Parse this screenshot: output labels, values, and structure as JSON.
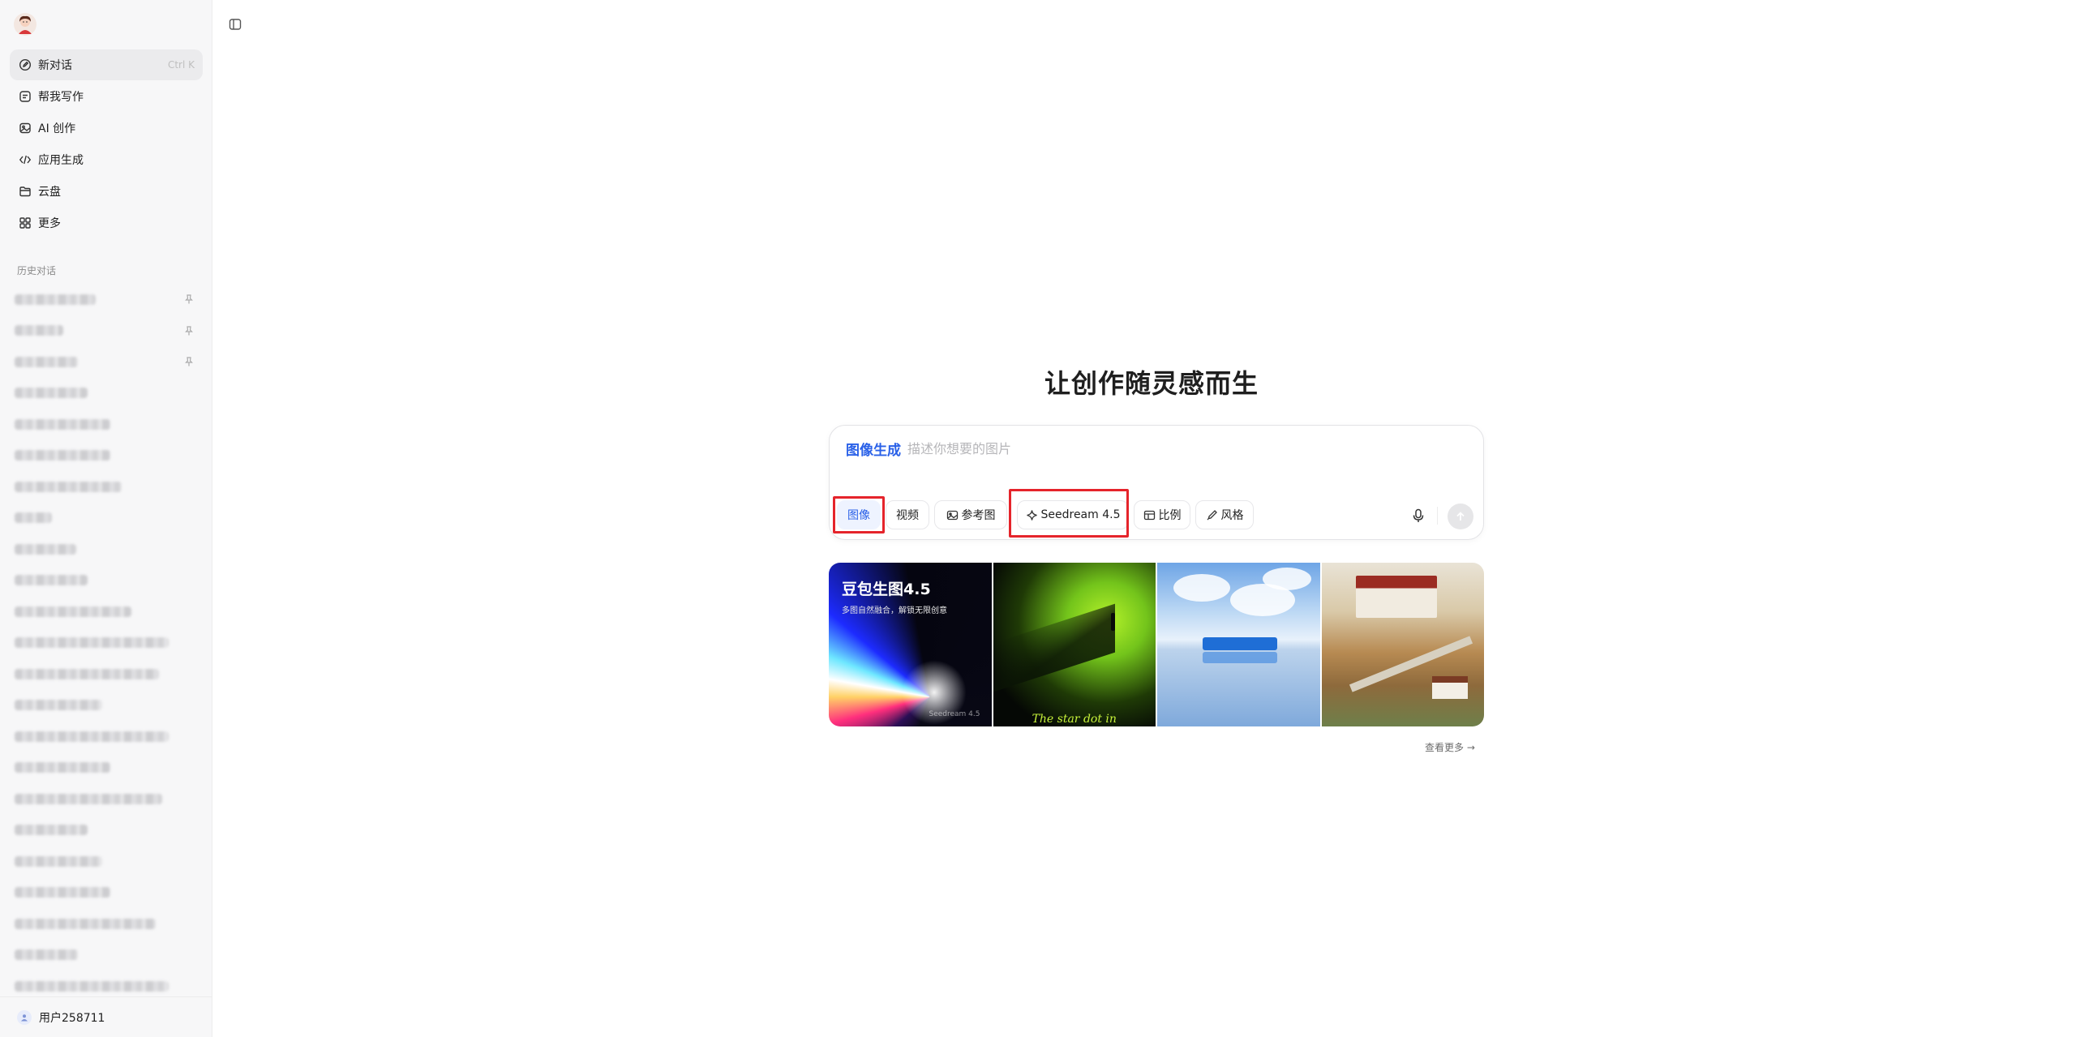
{
  "sidebar": {
    "nav": [
      {
        "label": "新对话",
        "shortcut": "Ctrl K",
        "icon": "edit-icon",
        "active": true
      },
      {
        "label": "帮我写作",
        "icon": "writing-icon"
      },
      {
        "label": "AI 创作",
        "icon": "image-icon"
      },
      {
        "label": "应用生成",
        "icon": "code-icon"
      },
      {
        "label": "云盘",
        "icon": "folder-icon"
      },
      {
        "label": "更多",
        "icon": "grid-icon"
      }
    ],
    "history_title": "历史对话",
    "history_count": 23,
    "user_name": "用户258711"
  },
  "main": {
    "title": "让创作随灵感而生",
    "composer": {
      "mode_tag": "图像生成",
      "placeholder": "描述你想要的图片",
      "chips": {
        "image": "图像",
        "video": "视频",
        "reference": "参考图",
        "model": "Seedream 4.5",
        "ratio": "比例",
        "style": "风格"
      }
    },
    "gallery": {
      "card1_title": "豆包生图4.5",
      "card1_subtitle": "多图自然融合，解锁无限创意",
      "card1_watermark": "Seedream 4.5",
      "card2_text": "The star dot in",
      "see_more": "查看更多 →"
    }
  },
  "colors": {
    "accent": "#2a61e8",
    "highlight_box": "#e5242b"
  }
}
